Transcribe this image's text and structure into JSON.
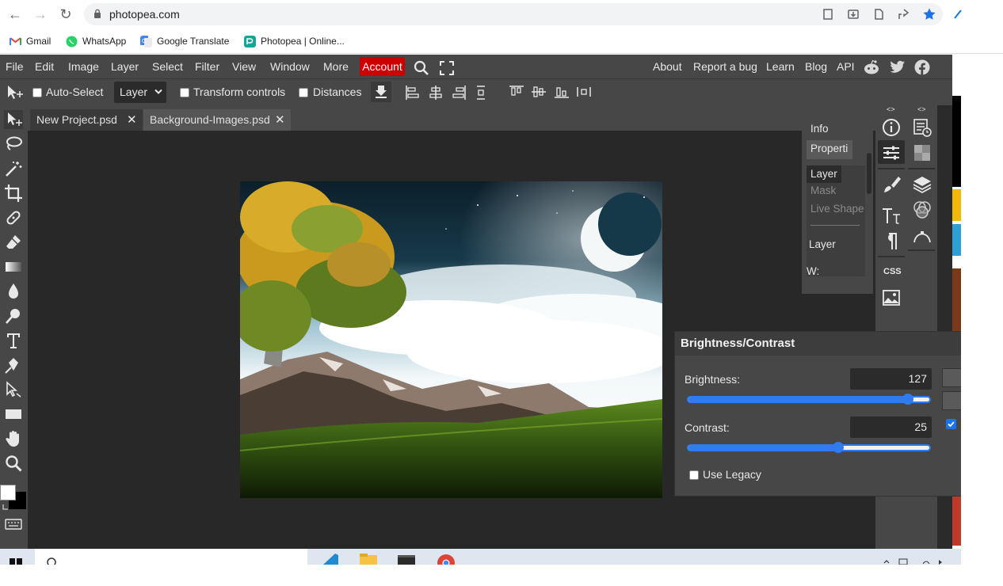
{
  "browser": {
    "url": "photopea.com",
    "bookmarks": [
      "Gmail",
      "WhatsApp",
      "Google Translate",
      "Photopea | Online..."
    ]
  },
  "photopea": {
    "menu": [
      "File",
      "Edit",
      "Image",
      "Layer",
      "Select",
      "Filter",
      "View",
      "Window",
      "More"
    ],
    "account_label": "Account",
    "right_links": [
      "About",
      "Report a bug",
      "Learn",
      "Blog",
      "API"
    ],
    "options": {
      "auto_select_label": "Auto-Select",
      "layer_select_value": "Layer",
      "transform_controls_label": "Transform controls",
      "distances_label": "Distances"
    },
    "tabs": [
      "New Project.psd",
      "Background-Images.psd"
    ],
    "mini_panel": {
      "info_label": "Info",
      "properties_label": "Properti",
      "layer_label": "Layer",
      "mask_label": "Mask",
      "live_shape_label": "Live Shape",
      "layer_heading": "Layer",
      "w_label": "W:"
    },
    "side_text_icon": "CSS",
    "dialog": {
      "title": "Brightness/Contrast",
      "brightness_label": "Brightness:",
      "brightness_value": "127",
      "contrast_label": "Contrast:",
      "contrast_value": "25",
      "use_legacy_label": "Use Legacy"
    }
  },
  "colors": {
    "accent": "#2f7bf0",
    "account_red": "#cc0000",
    "panel_bg": "#474747",
    "workspace_bg": "#282828"
  }
}
